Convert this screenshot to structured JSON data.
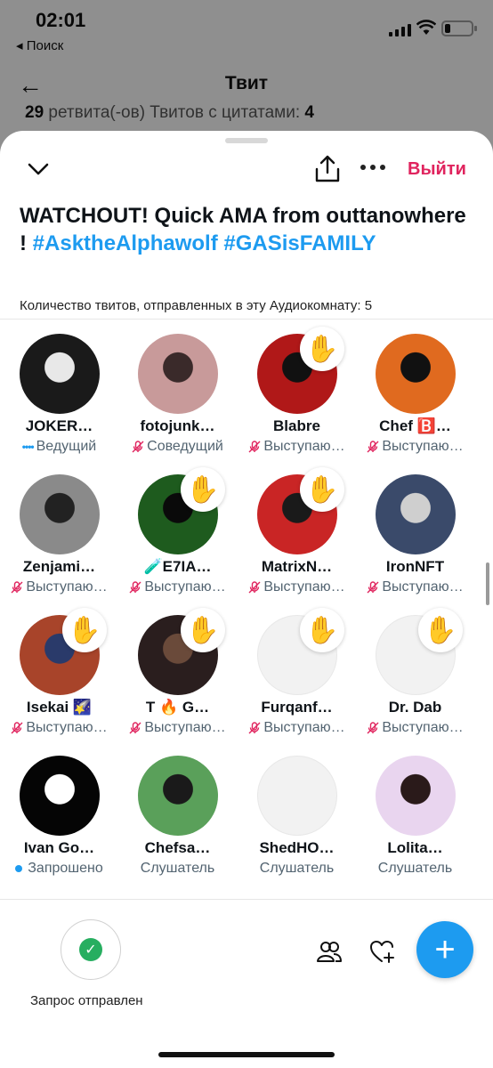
{
  "status": {
    "time": "02:01",
    "back_app": "◂ Поиск"
  },
  "background_screen": {
    "title": "Твит",
    "retweets_count": "29",
    "retweets_text": "ретвита(-ов)  Твитов с цитатами:",
    "quotes_count": "4"
  },
  "space": {
    "leave_label": "Выйти",
    "title_text": "WATCHOUT! Quick AMA from outtanowhere !",
    "hashtag1": "#AsktheAlphawolf",
    "hashtag2": "#GASisFAMILY",
    "tweet_count_text": "Количество твитов, отправленных в эту Аудиокомнату: 5"
  },
  "participants": [
    {
      "name": "JOKER…",
      "role": "Ведущий",
      "role_type": "host",
      "muted": false,
      "hand": "",
      "avatar_colors": [
        "#1a1a1a",
        "#e8e8e8"
      ]
    },
    {
      "name": "fotojunk…",
      "role": "Соведущий",
      "role_type": "cohost",
      "muted": true,
      "hand": "",
      "avatar_colors": [
        "#c89a9a",
        "#3a2a2a"
      ]
    },
    {
      "name": "Blabre",
      "role": "Выступаю…",
      "role_type": "speaker",
      "muted": true,
      "hand": "light",
      "avatar_colors": [
        "#b01818",
        "#111111"
      ]
    },
    {
      "name": "Chef 🅱️…",
      "role": "Выступаю…",
      "role_type": "speaker",
      "muted": true,
      "hand": "",
      "avatar_colors": [
        "#e06a1f",
        "#111111"
      ]
    },
    {
      "name": "Zenjami…",
      "role": "Выступаю…",
      "role_type": "speaker",
      "muted": true,
      "hand": "",
      "avatar_colors": [
        "#8a8a8a",
        "#222222"
      ]
    },
    {
      "name": "🧪E7IA…",
      "role": "Выступаю…",
      "role_type": "speaker",
      "muted": true,
      "hand": "light",
      "avatar_colors": [
        "#1e5b1e",
        "#0a0a0a"
      ]
    },
    {
      "name": "MatrixN…",
      "role": "Выступаю…",
      "role_type": "speaker",
      "muted": true,
      "hand": "light",
      "avatar_colors": [
        "#c92525",
        "#1a1a1a"
      ]
    },
    {
      "name": "IronNFT",
      "role": "Выступаю…",
      "role_type": "speaker",
      "muted": true,
      "hand": "",
      "avatar_colors": [
        "#3a4a6a",
        "#cfcfcf"
      ]
    },
    {
      "name": "Isekai 🌠",
      "role": "Выступаю…",
      "role_type": "speaker",
      "muted": true,
      "hand": "light",
      "avatar_colors": [
        "#a8442a",
        "#2a3a6a"
      ]
    },
    {
      "name": "T 🔥 G…",
      "role": "Выступаю…",
      "role_type": "speaker",
      "muted": true,
      "hand": "dark",
      "avatar_colors": [
        "#2a1e1e",
        "#6a4a3a"
      ]
    },
    {
      "name": "Furqanf…",
      "role": "Выступаю…",
      "role_type": "speaker",
      "muted": true,
      "hand": "light",
      "avatar_colors": [
        "#f2f2f2",
        "#f2f2f2"
      ]
    },
    {
      "name": "Dr. Dab",
      "role": "Выступаю…",
      "role_type": "speaker",
      "muted": true,
      "hand": "dark",
      "avatar_colors": [
        "#f2f2f2",
        "#f2f2f2"
      ]
    },
    {
      "name": "Ivan Go…",
      "role": "Запрошено",
      "role_type": "requested",
      "muted": false,
      "hand": "",
      "avatar_colors": [
        "#050505",
        "#ffffff"
      ]
    },
    {
      "name": "Chefsa…",
      "role": "Слушатель",
      "role_type": "listener",
      "muted": false,
      "hand": "",
      "avatar_colors": [
        "#5aa05a",
        "#1a1a1a"
      ]
    },
    {
      "name": "ShedHO…",
      "role": "Слушатель",
      "role_type": "listener",
      "muted": false,
      "hand": "",
      "avatar_colors": [
        "#f2f2f2",
        "#f2f2f2"
      ]
    },
    {
      "name": "Lolita…",
      "role": "Слушатель",
      "role_type": "listener",
      "muted": false,
      "hand": "",
      "avatar_colors": [
        "#e9d5ef",
        "#2a1a1a"
      ]
    }
  ],
  "bottom": {
    "request_label": "Запрос отправлен",
    "fab_symbol": "+"
  },
  "colors": {
    "accent": "#1d9bf0",
    "leave": "#e0245e",
    "muted_mic": "#e0245e",
    "check": "#27ae60"
  }
}
